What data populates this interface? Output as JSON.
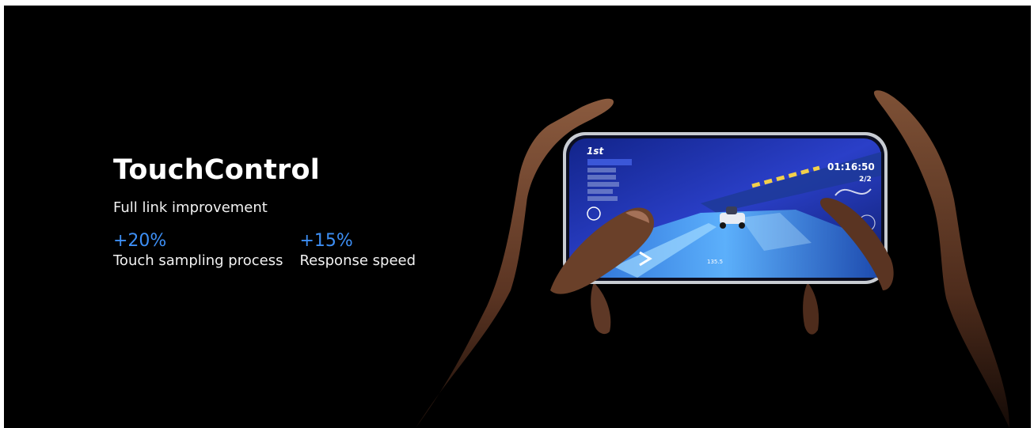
{
  "feature": {
    "title": "TouchControl",
    "subtitle": "Full link improvement",
    "stats": [
      {
        "value": "+20%",
        "label": "Touch sampling process"
      },
      {
        "value": "+15%",
        "label": "Response speed"
      }
    ]
  },
  "game_hud": {
    "position": "1st",
    "timer": "01:16:50",
    "lap": "2/2",
    "speed": "135.5"
  },
  "colors": {
    "background": "#000000",
    "accent": "#3d8ff5",
    "text": "#ffffff"
  }
}
